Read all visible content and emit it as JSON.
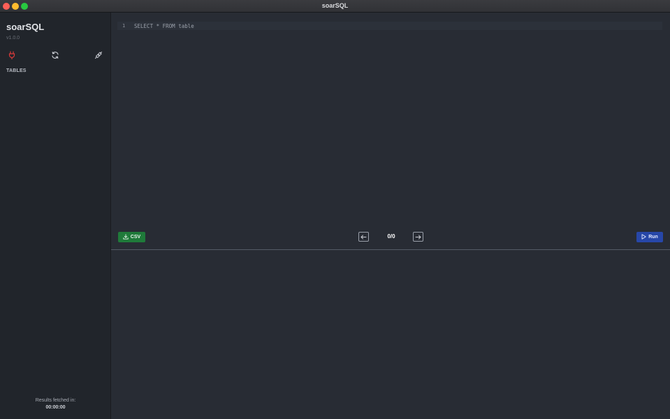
{
  "window": {
    "title": "soarSQL"
  },
  "sidebar": {
    "app_name": "soarSQL",
    "version": "v1.0.0",
    "icons": [
      "plug-icon",
      "refresh-icon",
      "disconnect-icon"
    ],
    "tables_heading": "TABLES",
    "fetch_label": "Results fetched in:",
    "fetch_time": "00:00:00"
  },
  "editor": {
    "line_number": "1",
    "query": "SELECT * FROM table"
  },
  "toolbar": {
    "csv_label": "CSV",
    "run_label": "Run",
    "page_count": "0/0"
  },
  "colors": {
    "accent_csv": "#1f7a3a",
    "accent_run": "#2747a8",
    "plug_icon": "#d93a3a"
  }
}
